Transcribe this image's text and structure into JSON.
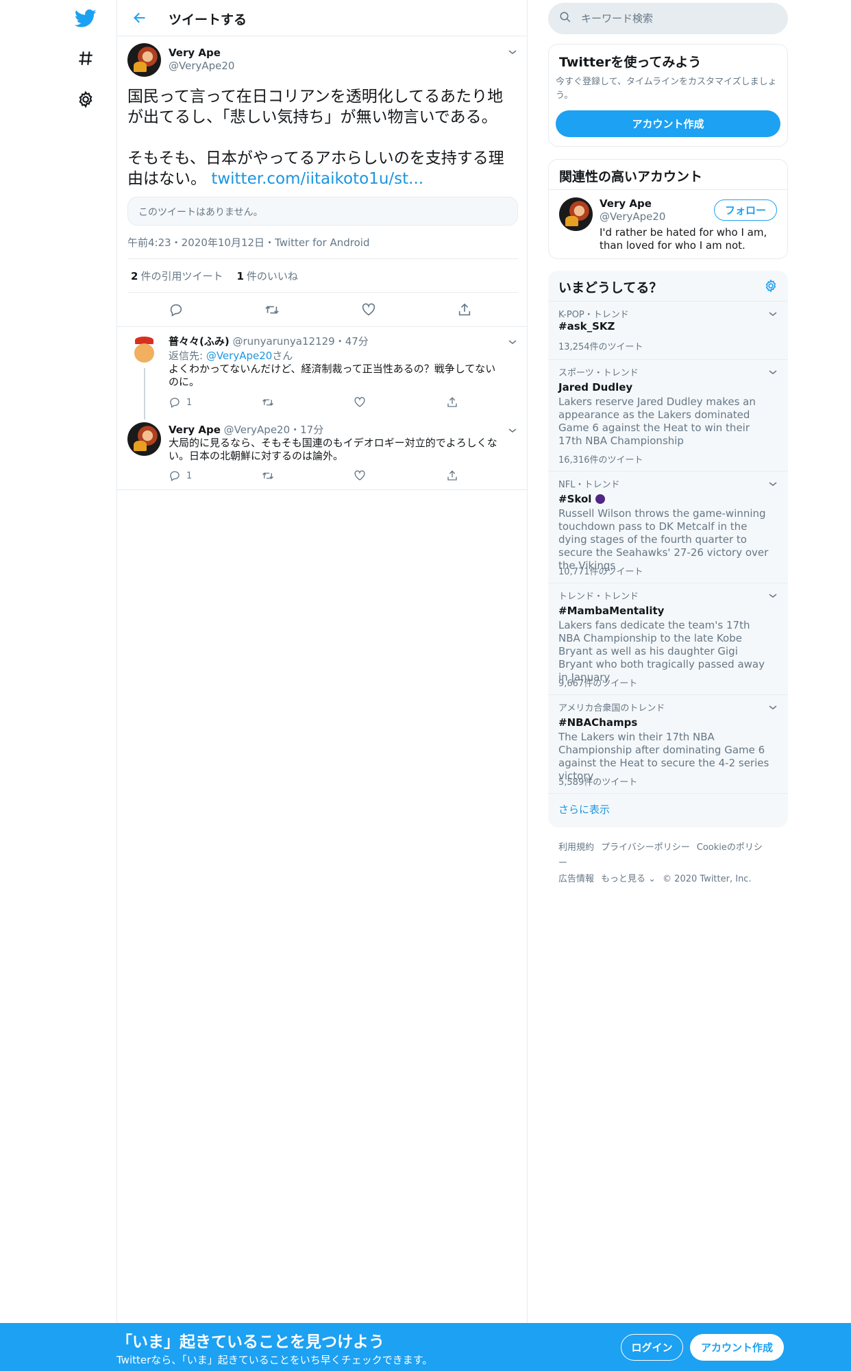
{
  "header": {
    "title": "ツイートする"
  },
  "colors": {
    "accent": "#1da1f2",
    "text": "#14171a",
    "muted": "#657786",
    "border": "#e6ecf0",
    "link": "#1b95e0"
  },
  "tweet": {
    "author_name": "Very Ape",
    "author_handle": "@VeryApe20",
    "text_part1": "国民って言って在日コリアンを透明化してるあたり地が出てるし、「悲しい気持ち」が無い物言いである。\n\nそもそも、日本がやってるアホらしいのを支持する理由はない。 ",
    "text_link": "twitter.com/iitaikoto1u/st...",
    "quoted_missing": "このツイートはありません。",
    "meta": "午前4:23・2020年10月12日・Twitter for Android",
    "quote_count": "2",
    "quote_label": "件の引用ツイート",
    "like_count": "1",
    "like_label": "件のいいね"
  },
  "replies": [
    {
      "name": "普々々(ふみ)",
      "handle": "@runyarunya12129",
      "time": "・47分",
      "reply_to_prefix": "返信先: ",
      "reply_to_handle": "@VeryApe20",
      "reply_to_suffix": "さん",
      "text": "よくわかってないんだけど、経済制裁って正当性あるの？戦争してないのに。",
      "reply_count": "1"
    },
    {
      "name": "Very Ape",
      "handle": "@VeryApe20",
      "time": "・17分",
      "text": "大局的に見るなら、そもそも国連のもイデオロギー対立的でよろしくない。日本の北朝鮮に対するのは論外。",
      "reply_count": "1"
    }
  ],
  "search": {
    "placeholder": "キーワード検索"
  },
  "signup_card": {
    "title": "Twitterを使ってみよう",
    "desc": "今すぐ登録して、タイムラインをカスタマイズしましょう。",
    "button": "アカウント作成"
  },
  "related": {
    "title": "関連性の高いアカウント",
    "name": "Very Ape",
    "handle": "@VeryApe20",
    "bio": "I'd rather be hated for who I am, than loved for who I am not.",
    "follow": "フォロー"
  },
  "trends": {
    "title": "いまどうしてる？",
    "items": [
      {
        "context": "K-POP・トレンド",
        "name": "#ask_SKZ",
        "desc": "",
        "count": "13,254件のツイート"
      },
      {
        "context": "スポーツ・トレンド",
        "name": "Jared Dudley",
        "desc": "Lakers reserve Jared Dudley makes an appearance as the Lakers dominated Game 6 against the Heat to win their 17th NBA Championship",
        "count": "16,316件のツイート"
      },
      {
        "context": "NFL・トレンド",
        "name": "#Skol",
        "desc": "Russell Wilson throws the game-winning touchdown pass to DK Metcalf in the dying stages of the fourth quarter to secure the Seahawks' 27-26 victory over the Vikings",
        "count": "10,771件のツイート"
      },
      {
        "context": "トレンド・トレンド",
        "name": "#MambaMentality",
        "desc": "Lakers fans dedicate the team's 17th NBA Championship to the late Kobe Bryant as well as his daughter Gigi Bryant who both tragically passed away in January",
        "count": "9,667件のツイート"
      },
      {
        "context": "アメリカ合衆国のトレンド",
        "name": "#NBAChamps",
        "desc": "The Lakers win their 17th NBA Championship after dominating Game 6 against the Heat to secure the 4-2 series victory",
        "count": "5,589件のツイート"
      }
    ],
    "show_more": "さらに表示"
  },
  "footer": {
    "terms": "利用規約",
    "privacy": "プライバシーポリシー",
    "cookie": "Cookieのポリシー",
    "ads": "広告情報",
    "more": "もっと見る ⌄",
    "copyright": "© 2020 Twitter, Inc."
  },
  "bottom_bar": {
    "title": "「いま」起きていることを見つけよう",
    "subtitle": "Twitterなら、「いま」起きていることをいち早くチェックできます。",
    "login": "ログイン",
    "signup": "アカウント作成"
  }
}
